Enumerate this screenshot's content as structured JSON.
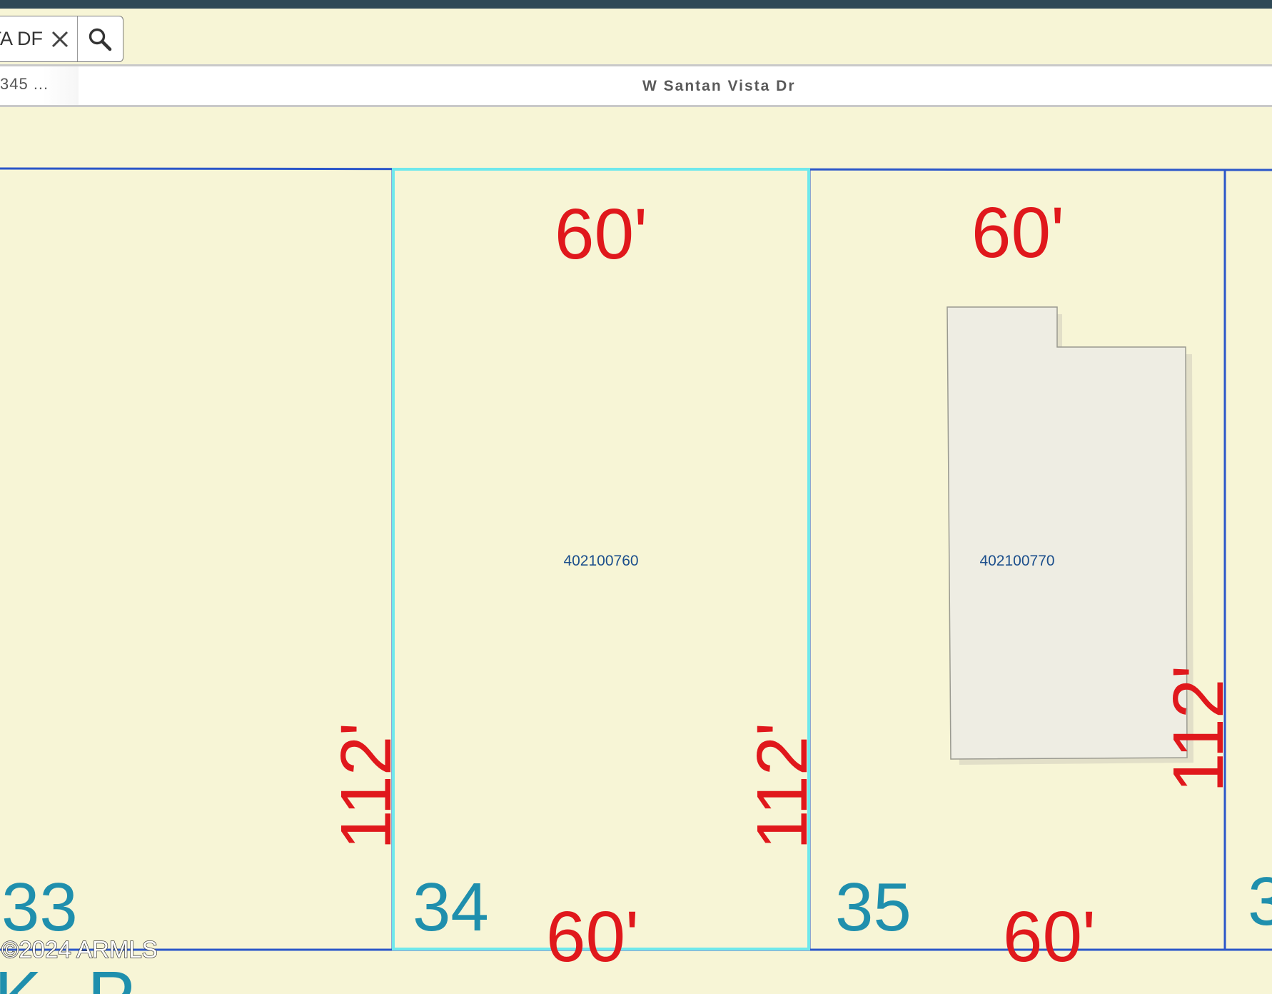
{
  "search": {
    "value": "TA DF",
    "clear_icon": "close-icon",
    "search_icon": "search-icon"
  },
  "street_bar": {
    "address_fragment": "345 ...",
    "street_name": "W Santan Vista Dr"
  },
  "parcels": [
    {
      "lot": "33",
      "right_depth": "112'"
    },
    {
      "lot": "34",
      "parcel_id": "402100760",
      "top_width": "60'",
      "bottom_width": "60'",
      "right_depth": "112'",
      "selected": true
    },
    {
      "lot": "35",
      "parcel_id": "402100770",
      "top_width": "60'",
      "bottom_width": "60'",
      "right_depth": "112'"
    },
    {
      "lot": "3"
    }
  ],
  "bottom_fragment": "K P",
  "copyright": "©2024 ARMLS",
  "colors": {
    "map_background": "#f7f5d6",
    "parcel_line": "#2b56c9",
    "selected_outline": "#6fe8ec",
    "dimension_text": "#e0181c",
    "lot_number": "#1f8fad",
    "parcel_id_text": "#1c4f8c",
    "building": "#eeede3",
    "top_bar": "#2f4956"
  }
}
